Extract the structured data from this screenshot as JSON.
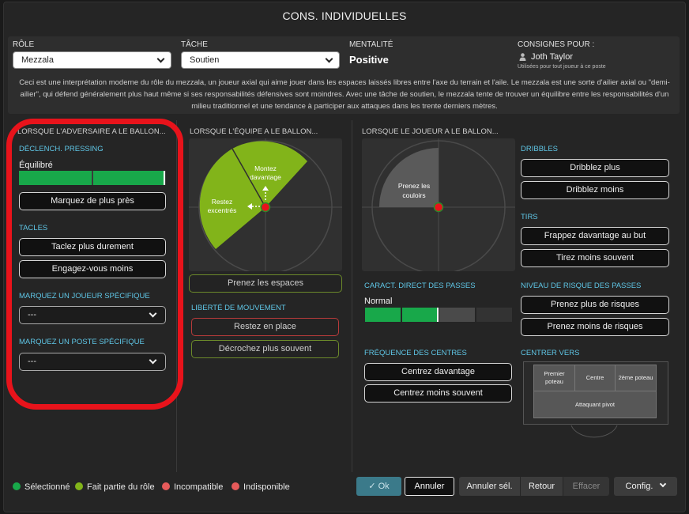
{
  "title": "CONS. INDIVIDUELLES",
  "header": {
    "role_label": "RÔLE",
    "role_value": "Mezzala",
    "task_label": "TÂCHE",
    "task_value": "Soutien",
    "mentality_label": "MENTALITÉ",
    "mentality_value": "Positive",
    "instructions_for_label": "CONSIGNES POUR :",
    "player_name": "Joth Taylor",
    "player_note": "Utilisées pour tout joueur à ce poste",
    "description": "Ceci est une interprétation moderne du rôle du mezzala, un joueur axial qui aime jouer dans les espaces laissés libres entre l'axe du terrain et l'aile. Le mezzala est une sorte d'ailier axial ou \"demi-ailier\", qui défend généralement plus haut même si ses responsabilités défensives sont moindres. Avec une tâche de soutien, le mezzala tente de trouver un équilibre entre les responsabilités d'un milieu traditionnel et une tendance à participer aux attaques dans les trente derniers mètres."
  },
  "col1": {
    "heading": "LORSQUE L'ADVERSAIRE A LE BALLON...",
    "pressing_label": "DÉCLENCH. PRESSING",
    "pressing_value": "Équilibré",
    "pressing_level": 1.0,
    "mark_closer": "Marquez de plus près",
    "tackles_label": "TACLES",
    "tackle_harder": "Taclez plus durement",
    "stay_on_feet": "Engagez-vous moins",
    "mark_player_label": "MARQUEZ UN JOUEUR SPÉCIFIQUE",
    "mark_player_value": "---",
    "mark_position_label": "MARQUEZ UN POSTE SPÉCIFIQUE",
    "mark_position_value": "---"
  },
  "col2": {
    "heading": "LORSQUE L'ÉQUIPE A LE BALLON...",
    "get_further_forward": "Montez davantage",
    "hold_position": "Restez excentrés",
    "roam_label": "Prenez les espaces",
    "freedom_label": "LIBERTÉ DE MOUVEMENT",
    "hold_position_btn": "Restez en place",
    "roam_btn": "Décrochez plus souvent"
  },
  "col3": {
    "heading": "LORSQUE LE JOUEUR A LE BALLON...",
    "take_corridors": "Prenez les couloirs",
    "passing_directness_label": "CARACT. DIRECT DES PASSES",
    "passing_directness_value": "Normal",
    "passing_directness_level": 0.5,
    "crossing_freq_label": "FRÉQUENCE DES CENTRES",
    "cross_more": "Centrez davantage",
    "cross_less": "Centrez moins souvent"
  },
  "col4": {
    "dribbling_label": "DRIBBLES",
    "dribble_more": "Dribblez plus",
    "dribble_less": "Dribblez moins",
    "shooting_label": "TIRS",
    "shoot_more": "Frappez davantage au but",
    "shoot_less": "Tirez moins souvent",
    "passing_risk_label": "NIVEAU DE RISQUE DES PASSES",
    "risk_more": "Prenez plus de risques",
    "risk_less": "Prenez moins de risques",
    "cross_to_label": "CENTRER VERS",
    "near_post": "Premier poteau",
    "centre": "Centre",
    "far_post": "2ème poteau",
    "target_forward": "Attaquant pivot"
  },
  "legend": {
    "selected": "Sélectionné",
    "part_of_role": "Fait partie du rôle",
    "incompatible": "Incompatible",
    "unavailable": "Indisponible"
  },
  "footer": {
    "ok": "Ok",
    "cancel": "Annuler",
    "cancel_sel": "Annuler sél.",
    "back": "Retour",
    "clear": "Effacer",
    "config": "Config."
  },
  "colors": {
    "selected": "#18a84a",
    "part_of_role": "#82b41a",
    "incompatible": "#e65a5a",
    "unavailable": "#e65a5a",
    "accent_cyan": "#5fc6e6",
    "annotation_red": "#e8131b"
  }
}
